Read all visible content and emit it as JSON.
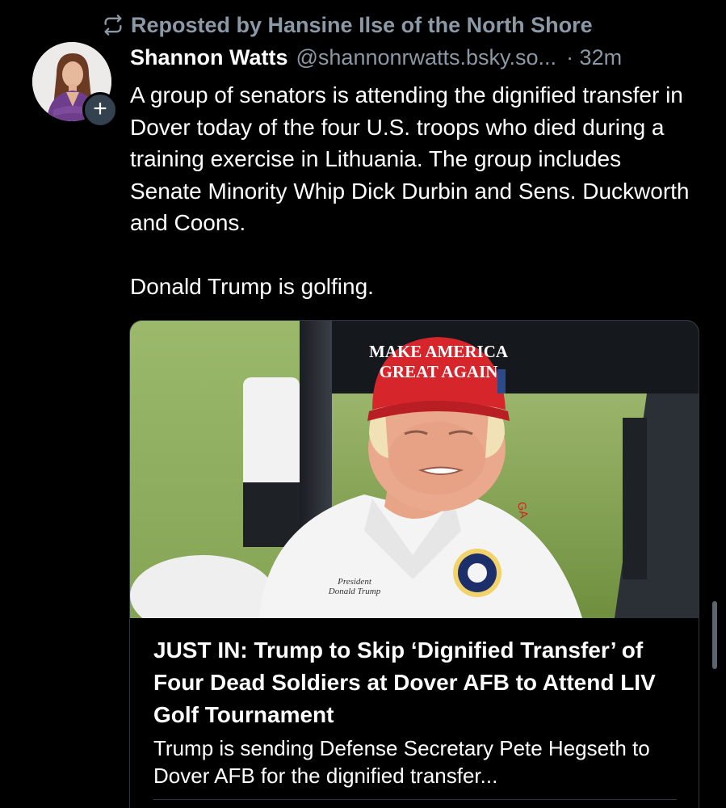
{
  "repost": {
    "label": "Reposted by Hansine Ilse of the North Shore",
    "icon": "repost-icon"
  },
  "post": {
    "author_name": "Shannon Watts",
    "author_handle": "@shannonrwatts.bsky.so...",
    "time": "· 32m",
    "follow_label": "+",
    "paragraph_1": "A group of senators is attending the dignified transfer in Dover today of the four U.S. troops who died during a training exercise in Lithuania. The group includes Senate Minority Whip Dick Durbin and Sens. Duckworth and Coons.",
    "paragraph_2": "Donald Trump is golfing."
  },
  "link_card": {
    "image_hat_line_1": "MAKE AMERICA",
    "image_hat_line_2": "GREAT AGAIN",
    "image_shirt_text_1": "President",
    "image_shirt_text_2": "Donald Trump",
    "title": "JUST IN: Trump to Skip ‘Dignified Transfer’ of Four Dead Soldiers at Dover AFB to Attend LIV Golf Tournament",
    "description": "Trump is sending Defense Secretary Pete Hegseth to Dover AFB for the dignified transfer..."
  },
  "colors": {
    "background": "#000000",
    "muted_text": "#8b98a5",
    "card_border": "#2c3640",
    "hat_red": "#d6262c"
  }
}
